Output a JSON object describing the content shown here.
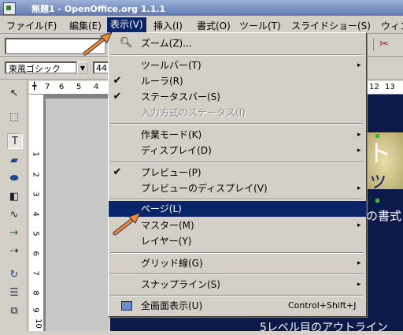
{
  "window": {
    "title": "無題1 - OpenOffice.org 1.1.1"
  },
  "menubar": {
    "items": [
      "ファイル(F)",
      "編集(E)",
      "表示(V)",
      "挿入(I)",
      "書式(O)",
      "ツール(T)",
      "スライドショー(S)",
      "ウィン"
    ]
  },
  "toolbar": {
    "font_name": "東風ゴシック",
    "font_size": "44"
  },
  "hruler_left": {
    "ticks": [
      "7",
      "6",
      "5",
      "4"
    ]
  },
  "hruler_right": {
    "ticks": [
      "12",
      "13"
    ]
  },
  "vruler": {
    "ticks": [
      "1",
      "2",
      "3",
      "4",
      "5",
      "6",
      "7",
      "8",
      "9",
      "10"
    ]
  },
  "slide": {
    "text_top": "ト",
    "text_mid": "ッ",
    "text_sub": "の書式",
    "bullet": "5レベル目のアウトライン"
  },
  "view_menu": {
    "zoom": "ズーム(Z)...",
    "toolbars": "ツールバー(T)",
    "ruler": "ルーラ(R)",
    "statusbar": "ステータスバー(S)",
    "input_status": "入力方式のステータス(I)",
    "workspace": "作業モード(K)",
    "display": "ディスプレイ(D)",
    "preview": "プレビュー(P)",
    "preview_display": "プレビューのディスプレイ(V)",
    "page": "ページ(L)",
    "master": "マスター(M)",
    "layer": "レイヤー(Y)",
    "grid": "グリッド線(G)",
    "snap": "スナップライン(S)",
    "fullscreen": "全画面表示(U)",
    "fullscreen_shortcut": "Control+Shift+J"
  }
}
